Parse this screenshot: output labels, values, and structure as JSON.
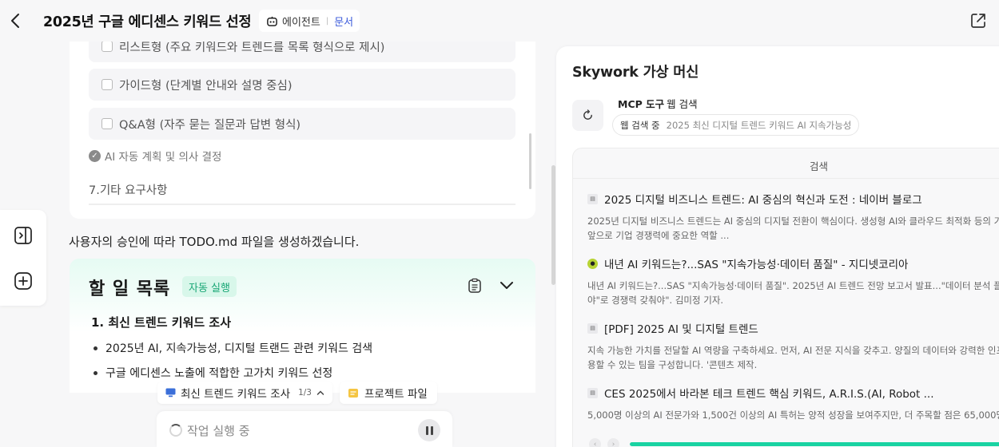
{
  "header": {
    "title": "2025년 구글 에디센스 키워드 선정",
    "agent_label": "에이전트",
    "doc_label": "문서"
  },
  "chat": {
    "options": [
      {
        "label": "리스트형 (주요 키워드와 트렌드를 목록 형식으로 제시)"
      },
      {
        "label": "가이드형 (단계별 안내와 설명 중심)"
      },
      {
        "label": "Q&A형 (자주 묻는 질문과 답변 형식)"
      }
    ],
    "ai_plan": "AI 자동 계획 및 의사 결정",
    "other_req": "7.기타 요구사항",
    "approval": "사용자의 승인에 따라 TODO.md 파일을 생성하겠습니다."
  },
  "todo": {
    "title": "할 일 목록",
    "badge": "자동 실행",
    "section1": "1. 최신 트렌드 키워드 조사",
    "items": [
      "2025년 AI, 지속가능성, 디지털 트랜드 관련 키워드 검색",
      "구글 에디센스 노출에 적합한 고가치 키워드 선정"
    ]
  },
  "task_pill": {
    "label": "최신 트렌드 키워드 조사",
    "counter": "1/3"
  },
  "file_pill": {
    "label": "프로젝트 파일"
  },
  "exec": {
    "status": "작업 실행 중"
  },
  "vm": {
    "title": "Skywork 가상 머신",
    "tool_name": "MCP 도구",
    "tool_type": "웹 검색",
    "query_status": "웹 검색 중",
    "query": "2025 최신 디지털 트렌드 키워드 AI 지속가능성",
    "search_header": "검색",
    "results": [
      {
        "title": "2025 디지털 비즈니스 트렌드: AI 중심의 혁신과 도전 : 네이버 블로그",
        "snippet": "2025년 디지털 비즈니스 트렌드는 AI 중심의 디지털 전환이 핵심이다. 생성형 AI와 클라우드 최적화 등의 기\n앞으로 기업 경쟁력에 중요한 역할 ..."
      },
      {
        "title": "내년 AI 키워드는?...SAS \"지속가능성·데이터 품질\" - 지디넷코리아",
        "snippet": "내년 AI 키워드는?...SAS \"지속가능성·데이터 품질\". 2025년 AI 트렌드 전망 보고서 발표...\"데이터 분석 플랫\n야\"로 경쟁력 갖춰야\". 김미정 기자."
      },
      {
        "title": "[PDF] 2025 AI 및 디지털 트렌드",
        "snippet": "지속 가능한 가치를 전달할 AI 역량을 구축하세요. 먼저, AI 전문 지식을 갖추고. 양질의 데이터와 강력한 인프\n용할 수 있는 팀을 구성합니다. '콘텐츠 제작."
      },
      {
        "title": "CES 2025에서 바라본 테크 트렌드 핵심 키워드, A.R.I.S.(AI, Robot ...",
        "snippet": "5,000명 이상의 AI 전문가와 1,500건 이상의 AI 특허는 양적 성장을 보여주지만, 더 주목할 점은 65,000명"
      }
    ],
    "progress": 1.0
  },
  "colors": {
    "accent_green": "#19d3a2",
    "badge_green": "#1aa776",
    "doc_blue": "#3b5bdb"
  },
  "icons": [
    "back-arrow-icon",
    "robot-icon",
    "share-icon",
    "sidebar-toggle-icon",
    "plus-icon",
    "clipboard-icon",
    "chevron-down-icon",
    "monitor-icon",
    "folder-icon",
    "refresh-icon",
    "pause-icon",
    "document-icon"
  ]
}
